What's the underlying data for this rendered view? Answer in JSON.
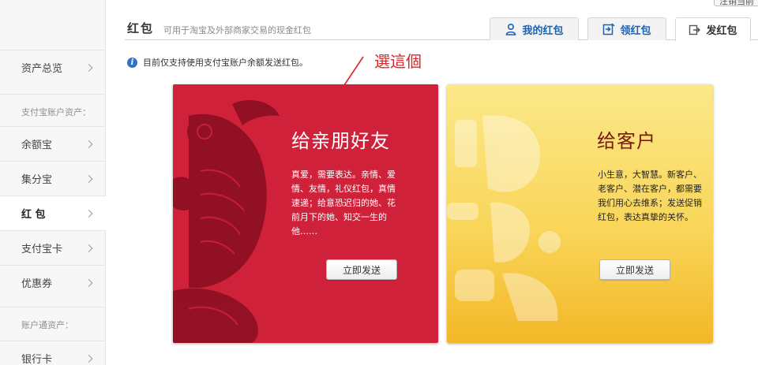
{
  "corner": {
    "label": "注销当前"
  },
  "sidebar": {
    "items": [
      {
        "label": "资产总览"
      },
      {
        "label": "余额宝"
      },
      {
        "label": "集分宝"
      },
      {
        "label": "红 包"
      },
      {
        "label": "支付宝卡"
      },
      {
        "label": "优惠券"
      },
      {
        "label": "银行卡"
      }
    ],
    "sections": [
      {
        "label": "支付宝账户资产："
      },
      {
        "label": "账户通资产："
      }
    ]
  },
  "header": {
    "title": "红包",
    "subtitle": "可用于淘宝及外部商家交易的现金红包",
    "tabs": [
      {
        "label": "我的红包",
        "icon": "user-icon"
      },
      {
        "label": "领红包",
        "icon": "receive-icon"
      },
      {
        "label": "发红包",
        "icon": "send-icon"
      }
    ]
  },
  "info": {
    "text": "目前仅支持使用支付宝账户余额发送红包。"
  },
  "annotation": {
    "text": "選這個"
  },
  "cards": {
    "friends": {
      "title": "给亲朋好友",
      "desc": "真爱，需要表达。亲情、爱情、友情，礼仪红包，真情速递；给意恐迟归的她、花前月下的她、知交一生的他……",
      "button": "立即发送"
    },
    "customers": {
      "title": "给客户",
      "desc": "小生意，大智慧。新客户、老客户、潜在客户，都需要我们用心去维系；发送促销红包，表达真挚的关怀。",
      "button": "立即发送"
    }
  },
  "colors": {
    "red_card": "#d0213a",
    "gold_card": "#f9d65a",
    "accent_blue": "#1b63b5",
    "annotation_red": "#d8232a"
  }
}
